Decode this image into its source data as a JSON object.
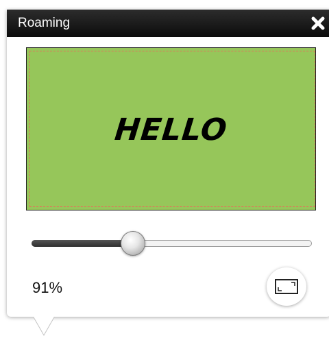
{
  "window": {
    "title": "Roaming",
    "close_icon": "close-icon"
  },
  "preview": {
    "text": "HELLO",
    "background_color": "#96c65a",
    "safe_area_color": "#e2735a"
  },
  "zoom": {
    "label": "91%",
    "slider_fraction": 0.36
  },
  "fit_button": {
    "icon": "fit-screen-icon"
  }
}
